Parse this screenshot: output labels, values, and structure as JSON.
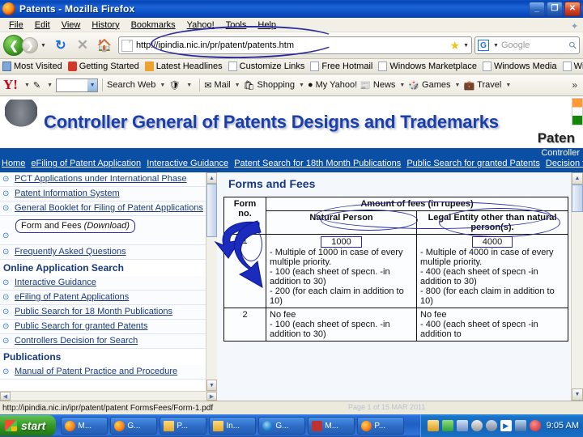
{
  "window": {
    "title": "Patents - Mozilla Firefox",
    "minimize_label": "_",
    "maximize_label": "❐",
    "close_label": "✕"
  },
  "menubar": {
    "items": [
      "File",
      "Edit",
      "View",
      "History",
      "Bookmarks",
      "Yahoo!",
      "Tools",
      "Help"
    ]
  },
  "navbar": {
    "back_label": "❮",
    "forward_label": "❯",
    "dropdown_label": "▾",
    "reload_label": "↻",
    "stop_label": "✕",
    "home_label": "⌂",
    "url": "http://ipindia.nic.in/pr/patent/patents.htm",
    "bookmark_star_label": "★",
    "search_engine_label": "G",
    "search_placeholder": "Google",
    "search_icon": "⚲"
  },
  "bookmarks": {
    "items": [
      {
        "label": "Most Visited",
        "icon": "star-icon"
      },
      {
        "label": "Getting Started",
        "icon": "firefox-icon"
      },
      {
        "label": "Latest Headlines",
        "icon": "feed-icon"
      },
      {
        "label": "Customize Links",
        "icon": "page-icon"
      },
      {
        "label": "Free Hotmail",
        "icon": "page-icon"
      },
      {
        "label": "Windows Marketplace",
        "icon": "page-icon"
      },
      {
        "label": "Windows Media",
        "icon": "page-icon"
      },
      {
        "label": "Windows",
        "icon": "page-icon"
      }
    ]
  },
  "yahoo_toolbar": {
    "logo": "Y!",
    "pencil_icon": "✎",
    "input_value": "",
    "items": [
      {
        "label": "Search Web",
        "icon": "search-icon"
      },
      {
        "label": "Mail",
        "icon": "mail-icon"
      },
      {
        "label": "Shopping",
        "icon": "shopping-icon"
      },
      {
        "label": "My Yahoo!",
        "icon": "my-yahoo-icon"
      },
      {
        "label": "News",
        "icon": "news-icon"
      },
      {
        "label": "Games",
        "icon": "games-icon"
      },
      {
        "label": "Travel",
        "icon": "travel-icon"
      }
    ],
    "overflow_label": "»"
  },
  "page": {
    "banner_title": "Controller General of Patents Designs and Trademarks",
    "banner_sub": "Paten",
    "nav_right_text": "Controller",
    "nav_links": [
      "Home",
      "eFiling of Patent Application",
      "Interactive Guidance",
      "Patent Search for 18th Month Publications",
      "Public Search for granted Patents",
      "Decision f"
    ],
    "sidebar": {
      "items": [
        {
          "label": "PCT Applications under International Phase",
          "type": "link"
        },
        {
          "label": "Patent Information System",
          "type": "link"
        },
        {
          "label": "General Booklet for Filing of Patent Applications",
          "type": "link"
        },
        {
          "label": "Form and Fees",
          "suffix": "(Download)",
          "type": "highlight"
        },
        {
          "label": "Frequently Asked Questions",
          "type": "link"
        },
        {
          "label": "Online Application Search",
          "type": "heading"
        },
        {
          "label": "Interactive Guidance",
          "type": "link"
        },
        {
          "label": "eFiling of Patent Applications",
          "type": "link"
        },
        {
          "label": "Public Search for 18 Month Publications",
          "type": "link"
        },
        {
          "label": "Public Search for granted Patents",
          "type": "link"
        },
        {
          "label": "Controllers Decision for Search",
          "type": "link"
        },
        {
          "label": "Publications",
          "type": "heading"
        },
        {
          "label": "Manual of Patent Practice and Procedure",
          "type": "link"
        }
      ],
      "bullet": "⊕"
    },
    "main": {
      "title": "Forms and Fees",
      "table": {
        "col_form_no": "Form no.",
        "col_amount": "Amount of fees (in rupees)",
        "col_natural": "Natural Person",
        "col_legal": "Legal Entity other than natural person(s).",
        "rows": [
          {
            "form_no": "1",
            "natural_fee": "1000",
            "natural_detail": "- Multiple of 1000 in case of every multiple priority.\n- 100 (each sheet of specn. -in addition to 30)\n- 200 (for each claim in  addition to 10)",
            "legal_fee": "4000",
            "legal_detail": "- Multiple of 4000 in case of every multiple priority.\n- 400 (each sheet of specn -in addition to 30)\n- 800 (for each claim in  addition to 10)"
          },
          {
            "form_no": "2",
            "natural_fee": "",
            "natural_detail": "No fee\n- 100 (each sheet of specn. -in addition to 30)",
            "legal_fee": "",
            "legal_detail": "No fee\n- 400 (each sheet of specn -in addition to"
          }
        ]
      }
    }
  },
  "statusbar": {
    "url": "http://ipindia.nic.in/ipr/patent/patent FormsFees/Form-1.pdf",
    "copyright": "Page 1 of 15 MAR 2011"
  },
  "taskbar": {
    "start_label": "start",
    "tasks": [
      {
        "label": "M...",
        "icon": "firefox-icon"
      },
      {
        "label": "G...",
        "icon": "firefox-icon"
      },
      {
        "label": "P...",
        "icon": "folder-icon"
      },
      {
        "label": "In...",
        "icon": "folder-icon"
      },
      {
        "label": "G...",
        "icon": "ie-icon"
      },
      {
        "label": "M...",
        "icon": "media-icon"
      },
      {
        "label": "P...",
        "icon": "firefox-icon"
      }
    ],
    "tray_icons": [
      "update-icon",
      "shield-icon",
      "network-icon",
      "block-icon",
      "disc-icon",
      "play-icon",
      "monitor-icon",
      "security-icon"
    ],
    "clock": "9:05 AM"
  }
}
